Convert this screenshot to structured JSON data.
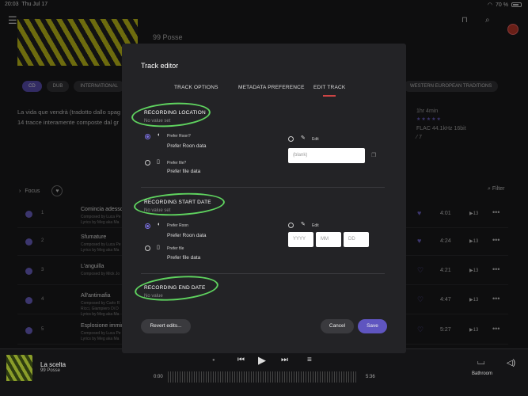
{
  "status": {
    "time": "20:03",
    "date": "Thu Jul 17",
    "battery": "70 %"
  },
  "album": {
    "artist": "99 Posse",
    "genres_left": [
      "CD",
      "DUB",
      "INTERNATIONAL"
    ],
    "genres_right": [
      "K",
      "WESTERN EUROPEAN TRADITIONS"
    ],
    "desc_line1": "La vida que vendrà (tradotto dallo spag",
    "desc_line2": "14 tracce interamente composte dal gr",
    "duration": "1hr 4min",
    "stars": "★★★★★",
    "quality": "FLAC 44.1kHz 16bit",
    "rating_count": "⁄ 7"
  },
  "list": {
    "focus": "Focus",
    "filter": "Filter"
  },
  "tracks": [
    {
      "num": "1",
      "title": "Comincia adesso",
      "sub1": "Composed by Luca Pe",
      "sub2": "Lyrics by Meg aka Ma",
      "dur": "4:01",
      "plays": "▶13"
    },
    {
      "num": "2",
      "title": "Sfumature",
      "sub1": "Composed by Luca Pe",
      "sub2": "Lyrics by Meg aka Ma",
      "dur": "4:24",
      "plays": "▶13"
    },
    {
      "num": "3",
      "title": "L'anguilla",
      "sub1": "Composed by Mick Jo",
      "sub2": "",
      "dur": "4:21",
      "plays": "▶13"
    },
    {
      "num": "4",
      "title": "All'antimafia",
      "sub1": "Composed by Carlo R",
      "sub2": "Ricci, Giampiero Di D",
      "sub3": "Lyrics by Meg aka Ma",
      "dur": "4:47",
      "plays": "▶13"
    },
    {
      "num": "5",
      "title": "Esplosione immin",
      "sub1": "Composed by Luca Pe",
      "sub2": "Lyrics by Meg aka Ma",
      "dur": "5:27",
      "plays": "▶13"
    }
  ],
  "player": {
    "title": "La scelta",
    "artist": "99 Posse",
    "elapsed": "0:00",
    "total": "5:36",
    "zone": "Bathroom"
  },
  "modal": {
    "title": "Track editor",
    "tabs": [
      "TRACK OPTIONS",
      "METADATA PREFERENCE",
      "EDIT TRACK"
    ],
    "sections": [
      {
        "title": "RECORDING LOCATION",
        "noval": "No value set",
        "opt1_small": "Prefer Roon?",
        "opt1_label": "Prefer Roon data",
        "opt2_small": "Prefer file?",
        "opt2_label": "Prefer file data",
        "edit": "Edit",
        "placeholder": "(blank)"
      },
      {
        "title": "RECORDING START DATE",
        "noval": "No value set",
        "opt1_small": "Prefer Roon",
        "opt1_label": "Prefer Roon data",
        "opt2_small": "Prefer file",
        "opt2_label": "Prefer file data",
        "edit": "Edit",
        "yyyy": "YYYY",
        "mm": "MM",
        "dd": "DD"
      },
      {
        "title": "RECORDING END DATE",
        "noval": "No value"
      }
    ],
    "buttons": {
      "revert": "Revert edits...",
      "cancel": "Cancel",
      "save": "Save"
    }
  },
  "colors": {
    "accent": "#6e63c9",
    "annotation": "#5fd35f",
    "tab_underline": "#cc4444"
  }
}
